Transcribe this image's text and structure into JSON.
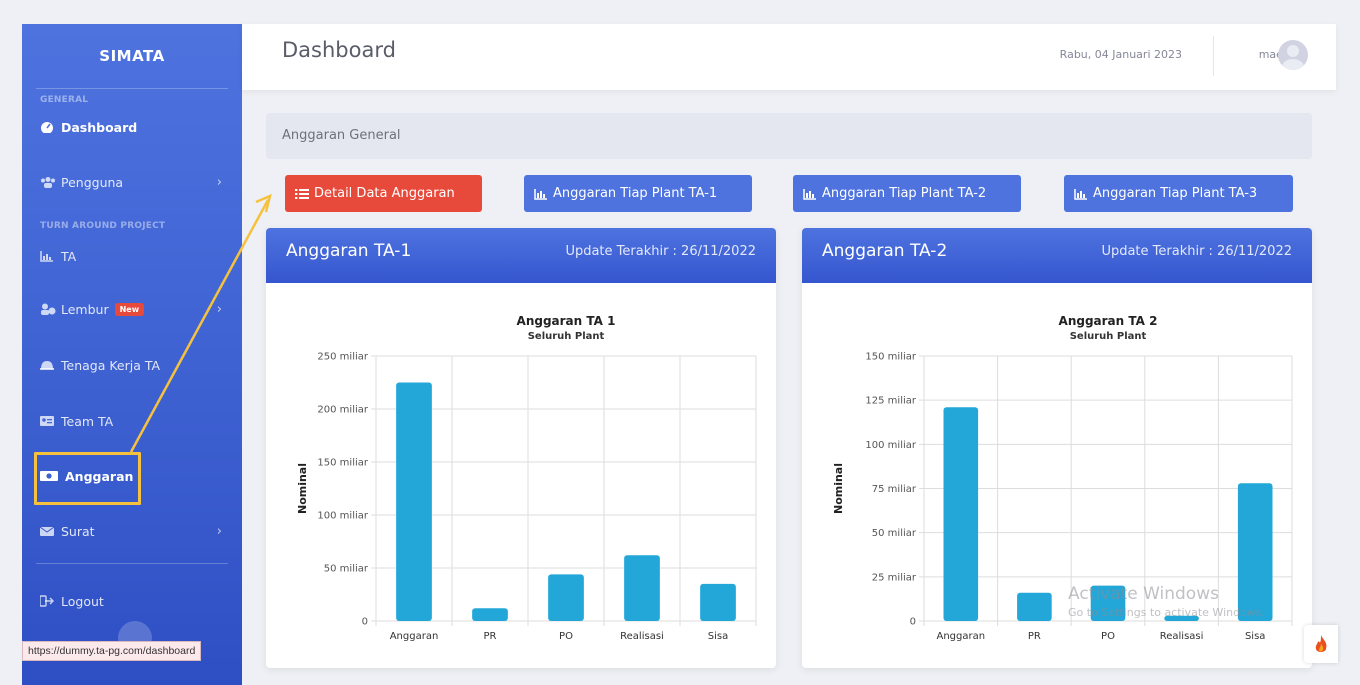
{
  "sidebar": {
    "brand": "SIMATA",
    "section_general": "GENERAL",
    "section_turn_around": "TURN AROUND PROJECT",
    "items": [
      {
        "label": "Dashboard",
        "icon": "tachometer-icon"
      },
      {
        "label": "Pengguna",
        "icon": "users-icon",
        "has_submenu": true
      },
      {
        "label": "TA",
        "icon": "chart-icon"
      },
      {
        "label": "Lembur",
        "icon": "user-clock-icon",
        "has_submenu": true,
        "badge": "New"
      },
      {
        "label": "Tenaga Kerja TA",
        "icon": "helmet-icon"
      },
      {
        "label": "Team TA",
        "icon": "id-card-icon"
      },
      {
        "label": "Anggaran",
        "icon": "money-icon",
        "active": true
      },
      {
        "label": "Surat",
        "icon": "envelope-icon",
        "has_submenu": true
      },
      {
        "label": "Logout",
        "icon": "sign-out-icon"
      }
    ],
    "status_url": "https://dummy.ta-pg.com/dashboard"
  },
  "topbar": {
    "title": "Dashboard",
    "date": "Rabu, 04 Januari 2023",
    "user": "mael"
  },
  "breadcrumb": "Anggaran General",
  "buttons": {
    "detail": "Detail Data Anggaran",
    "plant_ta1": "Anggaran Tiap Plant TA-1",
    "plant_ta2": "Anggaran Tiap Plant TA-2",
    "plant_ta3": "Anggaran Tiap Plant TA-3"
  },
  "cards": [
    {
      "title": "Anggaran TA-1",
      "update": "Update Terakhir : 26/11/2022"
    },
    {
      "title": "Anggaran TA-2",
      "update": "Update Terakhir : 26/11/2022"
    }
  ],
  "watermark": {
    "line1": "Activate Windows",
    "line2": "Go to Settings to activate Windows."
  },
  "colors": {
    "primary": "#4e73df",
    "danger": "#e74a3b",
    "bar": "#22a7d8",
    "highlight": "#f6c23e"
  },
  "chart_data": [
    {
      "type": "bar",
      "title": "Anggaran TA 1",
      "subtitle": "Seluruh Plant",
      "ylabel": "Nominal",
      "categories": [
        "Anggaran",
        "PR",
        "PO",
        "Realisasi",
        "Sisa"
      ],
      "values": [
        225,
        12,
        44,
        62,
        35
      ],
      "ylim": [
        0,
        250
      ],
      "yticks": [
        0,
        50,
        100,
        150,
        200,
        250
      ],
      "ytick_labels": [
        "0",
        "50 miliar",
        "100 miliar",
        "150 miliar",
        "200 miliar",
        "250 miliar"
      ],
      "unit": "miliar",
      "grid": true
    },
    {
      "type": "bar",
      "title": "Anggaran TA 2",
      "subtitle": "Seluruh Plant",
      "ylabel": "Nominal",
      "categories": [
        "Anggaran",
        "PR",
        "PO",
        "Realisasi",
        "Sisa"
      ],
      "values": [
        121,
        16,
        20,
        3,
        78
      ],
      "ylim": [
        0,
        150
      ],
      "yticks": [
        0,
        25,
        50,
        75,
        100,
        125,
        150
      ],
      "ytick_labels": [
        "0",
        "25 miliar",
        "50 miliar",
        "75 miliar",
        "100 miliar",
        "125 miliar",
        "150 miliar"
      ],
      "unit": "miliar",
      "grid": true
    }
  ]
}
